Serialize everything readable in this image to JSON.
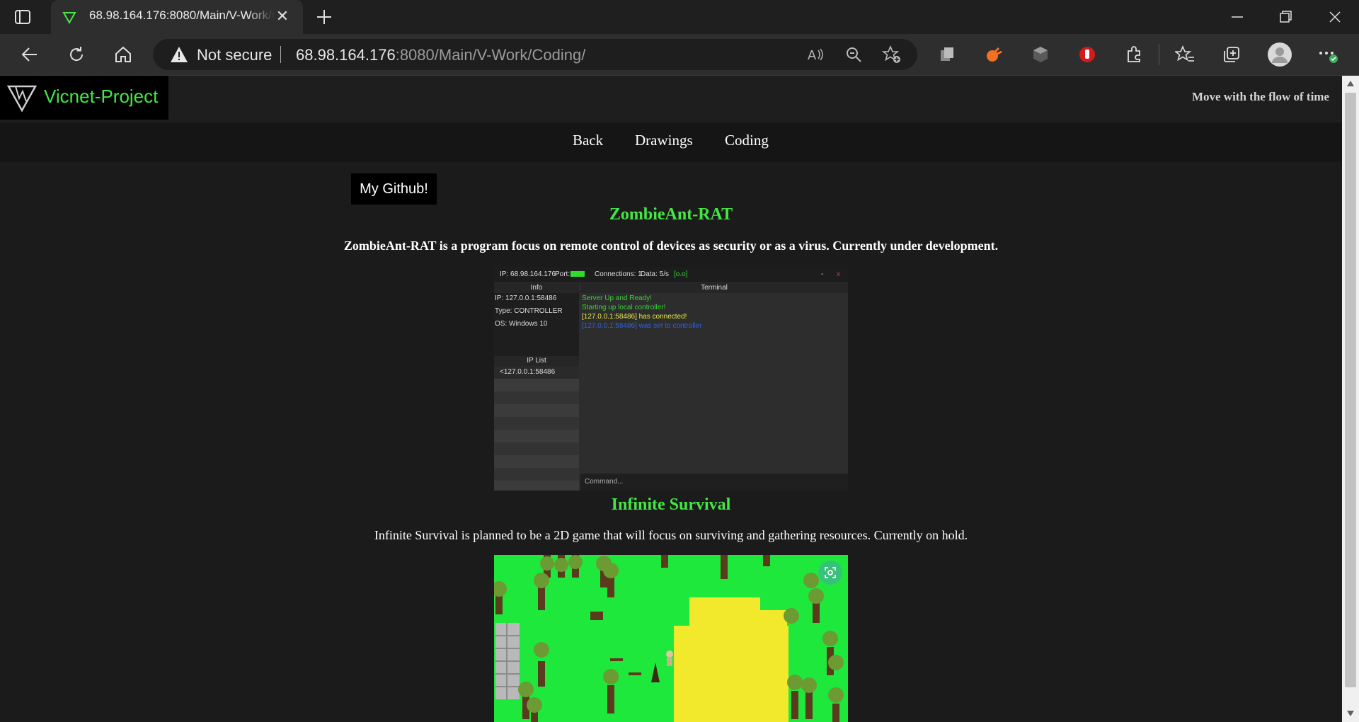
{
  "browser": {
    "tab_title": "68.98.164.176:8080/Main/V-Work/Coding/",
    "security_label": "Not secure",
    "url_host": "68.98.164.176",
    "url_rest": ":8080/Main/V-Work/Coding/"
  },
  "site": {
    "logo_text": "Vicnet-Project",
    "tagline": "Move with the flow of time",
    "nav": [
      "Back",
      "Drawings",
      "Coding"
    ],
    "github_button": "My Github!"
  },
  "sections": [
    {
      "title": "ZombieAnt-RAT",
      "description": "ZombieAnt-RAT is a program focus on remote control of devices as security or as a virus. Currently under development."
    },
    {
      "title": "Infinite Survival",
      "description": "Infinite Survival is planned to be a 2D game that will focus on surviving and gathering resources. Currently on hold."
    }
  ],
  "rat_screenshot": {
    "ip": "IP: 68.98.164.176",
    "port": "Port:",
    "connections": "Connections: 1",
    "data": "Data: 5/s",
    "face": "[o.o]",
    "minimize": "-",
    "close": "x",
    "info_header": "Info",
    "terminal_header": "Terminal",
    "info_lines": [
      "IP: 127.0.0.1:58486",
      "Type: CONTROLLER",
      "OS: Windows 10"
    ],
    "iplist_header": "IP List",
    "iplist_entry": "<127.0.0.1:58486",
    "terminal_lines": [
      {
        "text": "Server Up and Ready!",
        "color": "#37d437"
      },
      {
        "text": "Starting up local controller!",
        "color": "#37d437"
      },
      {
        "text": "[127.0.0.1:58486] has connected!",
        "color": "#e9e94a"
      },
      {
        "text": "[127.0.0.1:58486] was set to controller",
        "color": "#2f63d8"
      }
    ],
    "command_placeholder": "Command..."
  },
  "colors": {
    "accent_green": "#44e744",
    "page_bg": "#1b1b1b",
    "game_grass": "#1fe83c",
    "game_sand": "#f2e92c"
  }
}
